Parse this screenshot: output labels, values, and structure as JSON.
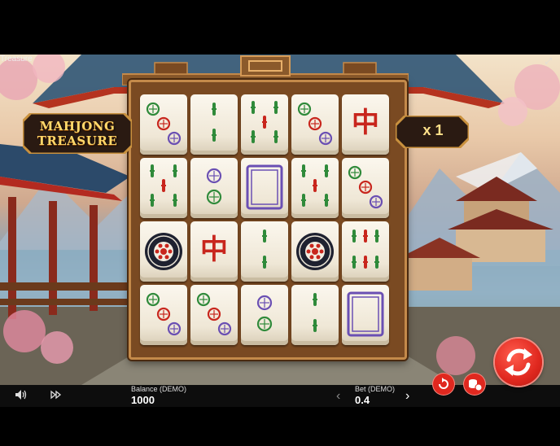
{
  "game": {
    "corner_title": "Treasure",
    "logo_line1": "MAHJONG",
    "logo_line2": "TREASURE",
    "multiplier": "x 1"
  },
  "grid": {
    "rows": [
      [
        "circles-3-diag",
        "bamboo-2",
        "bamboo-5",
        "circles-3-diag",
        "red-dragon"
      ],
      [
        "bamboo-5",
        "circles-2",
        "white-dragon",
        "bamboo-5",
        "circles-3-diag"
      ],
      [
        "circle-wild",
        "red-dragon",
        "bamboo-2",
        "circle-wild",
        "bamboo-6"
      ],
      [
        "circles-3-diag",
        "circles-3-diag",
        "circles-2",
        "bamboo-2",
        "white-dragon"
      ]
    ],
    "red_dragon_glyph": "中"
  },
  "bottom_bar": {
    "sound_icon": "speaker-icon",
    "turbo_icon": "fast-forward-icon",
    "balance_label": "Balance (DEMO)",
    "balance_value": "1000",
    "bet_label": "Bet (DEMO)",
    "bet_value": "0.4",
    "prev_glyph": "‹",
    "next_glyph": "›"
  },
  "colors": {
    "spin": "#e0281f",
    "tile": "#f6f1e4",
    "frame": "#7a4a22",
    "gold": "#ffd86b",
    "green": "#2f8a3a",
    "red": "#c8261d",
    "purple": "#6a4fb3"
  }
}
